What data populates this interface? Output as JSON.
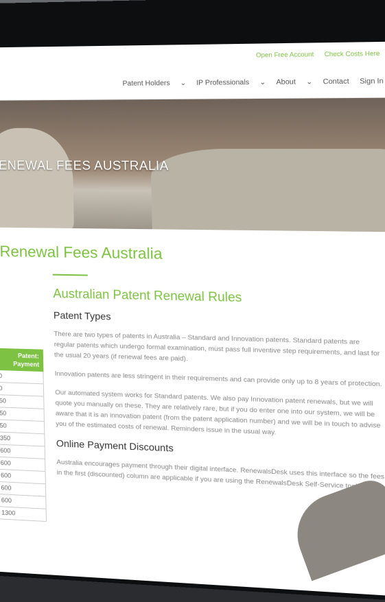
{
  "topbar": {
    "open_account": "Open Free Account",
    "check_costs": "Check Costs Here"
  },
  "nav": {
    "items": [
      "Patent Holders",
      "IP Professionals",
      "About",
      "Contact",
      "Sign In"
    ]
  },
  "hero": {
    "title": "RENEWAL FEES AUSTRALIA"
  },
  "main": {
    "page_title": "t Renewal Fees Australia",
    "section_title": "Australian Patent Renewal Rules",
    "subsection_title": "Patent Types",
    "para1": "There are two types of patents in Australia – Standard and Innovation patents. Standard patents are regular patents which undergo formal examination, must pass full inventive step requirements, and last for the usual 20 years (if renewal fees are paid).",
    "para2": "Innovation patents are less stringent in their requirements and can provide only up to 8 years of protection.",
    "para3": "Our automated system works for Standard patents. We also pay Innovation patent renewals, but we will quote you manually on these. They are relatively rare, but if you do enter one into our system, we will be aware that it is an innovation patent (from the patent application number) and we will be in touch to advise you of the estimated costs of renewal. Reminders issue in the usual way.",
    "subsection2_title": "Online Payment Discounts",
    "para4": "Australia encourages payment through their digital interface. RenewalsDesk uses this interface so the fees in the first (discounted) column are applicable if you are using the RenewalsDesk Self-Service tool."
  },
  "table": {
    "header": "Patent: Payment",
    "rows": [
      "0",
      "0",
      "50",
      "50",
      "50",
      "350",
      "600",
      "600",
      "600",
      "600",
      "600",
      "1300"
    ]
  }
}
